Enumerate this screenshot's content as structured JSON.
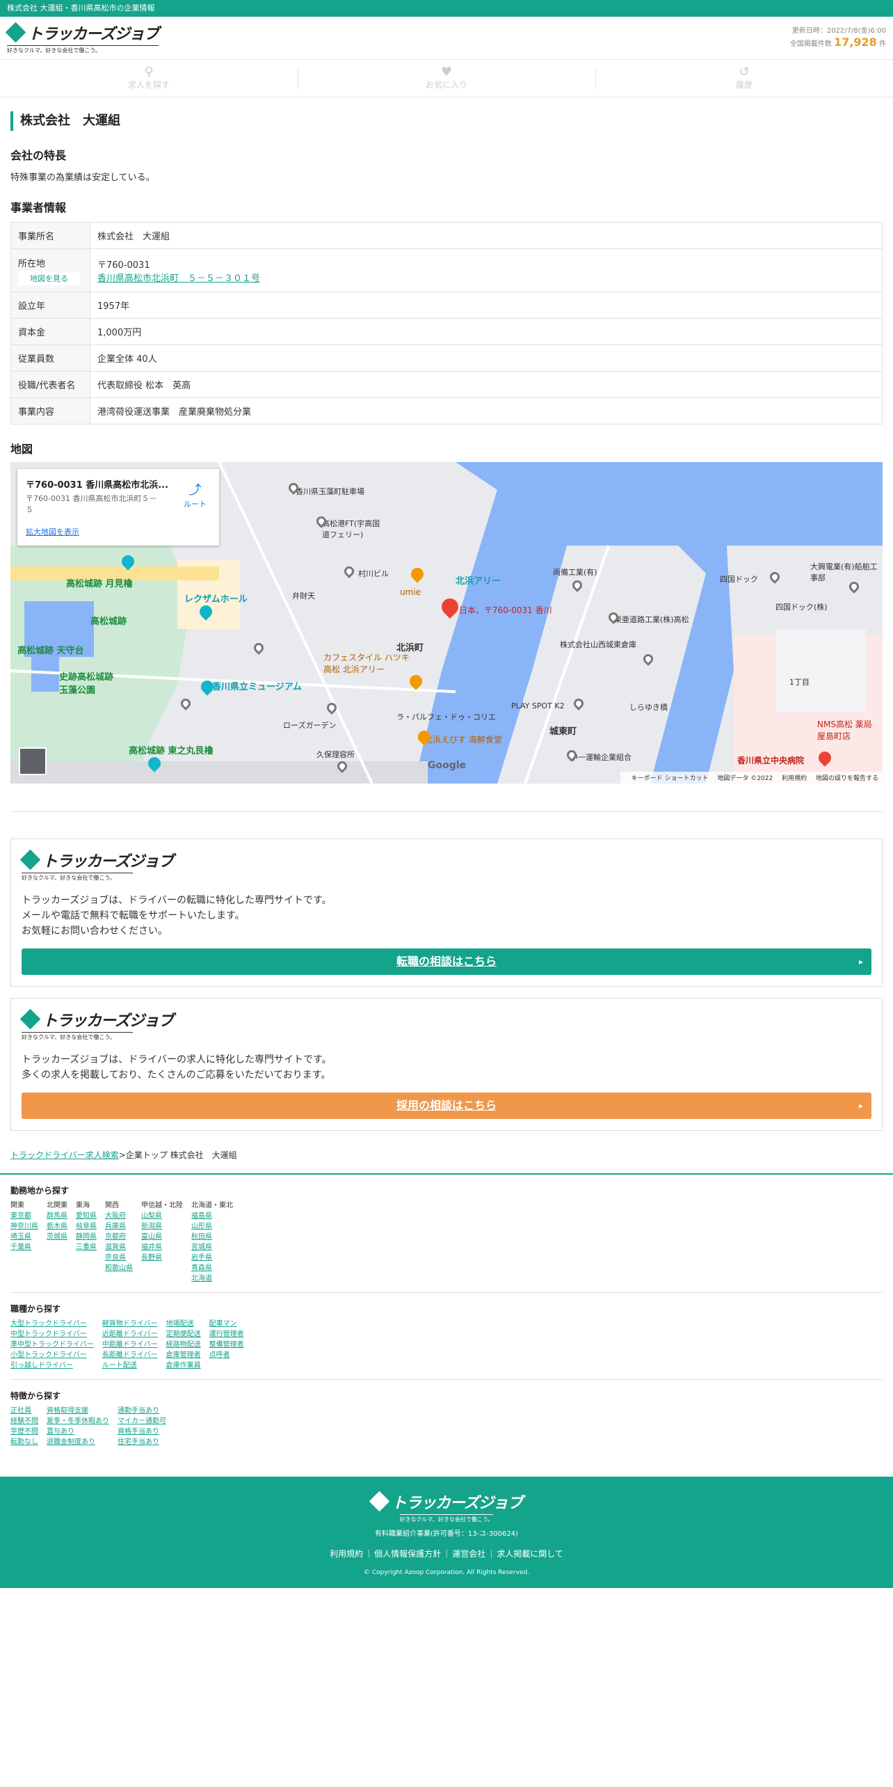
{
  "topbar": {
    "text": "株式会社 大運組・香川県高松市の企業情報"
  },
  "brand": {
    "name": "トラッカーズジョブ",
    "tagline": "好きなクルマ、好きな会社で働こう。"
  },
  "update": {
    "label": "更新日時：2022/7/8(金)6:00",
    "total_label": "全国掲載件数",
    "total_count": "17,928",
    "unit": "件"
  },
  "nav": [
    {
      "label": "求人を探す",
      "icon": "search-icon"
    },
    {
      "label": "お気に入り",
      "icon": "heart-icon"
    },
    {
      "label": "履歴",
      "icon": "history-icon"
    }
  ],
  "company": {
    "name": "株式会社　大運組"
  },
  "features": {
    "heading": "会社の特長",
    "text": "特殊事業の為業績は安定している。"
  },
  "info": {
    "heading": "事業者情報",
    "rows": [
      {
        "label": "事業所名",
        "value": "株式会社　大運組"
      },
      {
        "label": "所在地",
        "value": "〒760-0031",
        "link": "香川県高松市北浜町　５－５－３０１号",
        "button": "地図を見る"
      },
      {
        "label": "設立年",
        "value": "1957年"
      },
      {
        "label": "資本金",
        "value": "1,000万円"
      },
      {
        "label": "従業員数",
        "value": "企業全体 40人"
      },
      {
        "label": "役職/代表者名",
        "value": "代表取締役 松本　英高"
      },
      {
        "label": "事業内容",
        "value": "港湾荷役運送事業　産業廃棄物処分業"
      }
    ]
  },
  "map": {
    "heading": "地図",
    "card_title": "〒760-0031 香川県高松市北浜...",
    "card_address": "〒760-0031 香川県高松市北浜町５－５",
    "route": "ルート",
    "enlarge": "拡大地図を表示",
    "marker_label": "日本、〒760-0031 香川",
    "labels": {
      "l1": "香川県玉藻町駐車場",
      "l2": "高松港FT(宇高国道フェリー)",
      "l3": "村川ビル",
      "l4": "北浜アリー",
      "l5": "umie",
      "l6": "弁財天",
      "l7": "両備工業(有)",
      "l8": "四国ドック",
      "l9": "四国ドック(株)",
      "l10": "大興電業(有)船舶工事部",
      "l11": "高松城跡 月見櫓",
      "l12": "レクザムホール",
      "l13": "高松城跡",
      "l14": "高松城跡 天守台",
      "l15": "北浜町",
      "l16": "カフェスタイル ハツキ 高松 北浜アリー",
      "l17": "香川県立ミュージアム",
      "l18": "株式会社山西城東倉庫",
      "l19": "東亜道路工業(株)高松",
      "l20": "1丁目",
      "l21": "NMS高松 薬局 屋島町店",
      "l22": "香川県立中央病院",
      "l23": "城東町",
      "l24": "中一運輸企業組合",
      "l25": "高松城跡 東之丸艮櫓",
      "l26": "北浜えびす 海鮮食堂",
      "l27": "ローズガーデン",
      "l28": "ラ・パルフェ・ドゥ・コリエ",
      "l29": "PLAY SPOT K2",
      "l30": "しらゆき橋",
      "l31": "久保理容所",
      "l32": "史跡高松城跡 玉藻公園"
    },
    "footer": [
      "キーボード ショートカット",
      "地図データ ©2022",
      "利用規約",
      "地図の誤りを報告する"
    ],
    "google": "Google"
  },
  "promo1": {
    "lines": [
      "トラッカーズジョブは、ドライバーの転職に特化した専門サイトです。",
      "メールや電話で無料で転職をサポートいたします。",
      "お気軽にお問い合わせください。"
    ],
    "cta": "転職の相談はこちら"
  },
  "promo2": {
    "lines": [
      "トラッカーズジョブは、ドライバーの求人に特化した専門サイトです。",
      "多くの求人を掲載しており、たくさんのご応募をいただいております。"
    ],
    "cta": "採用の相談はこちら"
  },
  "breadcrumb": {
    "link": "トラックドライバー求人検索",
    "sep": ">企業トップ 株式会社　大運組"
  },
  "sitemap": {
    "area": {
      "title": "勤務地から探す",
      "cols": [
        {
          "head": "関東",
          "items": [
            "東京都",
            "神奈川県",
            "埼玉県",
            "千葉県"
          ]
        },
        {
          "head": "北関東",
          "items": [
            "群馬県",
            "栃木県",
            "茨城県"
          ]
        },
        {
          "head": "東海",
          "items": [
            "愛知県",
            "岐阜県",
            "静岡県",
            "三重県"
          ]
        },
        {
          "head": "関西",
          "items": [
            "大阪府",
            "兵庫県",
            "京都府",
            "滋賀県",
            "奈良県",
            "和歌山県"
          ]
        },
        {
          "head": "甲信越・北陸",
          "items": [
            "山梨県",
            "新潟県",
            "富山県",
            "福井県",
            "長野県"
          ]
        },
        {
          "head": "北海道・東北",
          "items": [
            "福島県",
            "山形県",
            "秋田県",
            "宮城県",
            "岩手県",
            "青森県",
            "北海道"
          ]
        }
      ]
    },
    "job": {
      "title": "職種から探す",
      "cols": [
        {
          "items": [
            "大型トラックドライバー",
            "中型トラックドライバー",
            "準中型トラックドライバー",
            "小型トラックドライバー",
            "引っ越しドライバー"
          ]
        },
        {
          "items": [
            "軽貨物ドライバー",
            "近距離ドライバー",
            "中距離ドライバー",
            "長距離ドライバー",
            "ルート配送"
          ]
        },
        {
          "items": [
            "地場配送",
            "定期便配送",
            "経路物配送",
            "倉庫管理者",
            "倉庫作業員"
          ]
        },
        {
          "items": [
            "配車マン",
            "運行管理者",
            "整備管理者",
            "点呼者"
          ]
        }
      ]
    },
    "feature": {
      "title": "特徴から探す",
      "cols": [
        {
          "items": [
            "正社員",
            "経験不問",
            "学歴不問",
            "転勤なし"
          ]
        },
        {
          "items": [
            "資格取得支援",
            "夏季・冬季休暇あり",
            "賞与あり",
            "退職金制度あり"
          ]
        },
        {
          "items": [
            "通勤手当あり",
            "マイカー通勤可",
            "資格手当あり",
            "住宅手当あり"
          ]
        }
      ]
    }
  },
  "footer": {
    "license": "有料職業紹介事業(許可番号：13-ユ-300624)",
    "links": [
      "利用規約",
      "個人情報保護方針",
      "運営会社",
      "求人掲載に関して"
    ],
    "copyright": "© Copyright Azoop Corporation. All Rights Reserved."
  },
  "colors": {
    "brand": "#14a38b",
    "accent": "#f1974a",
    "count": "#e89b2e"
  }
}
